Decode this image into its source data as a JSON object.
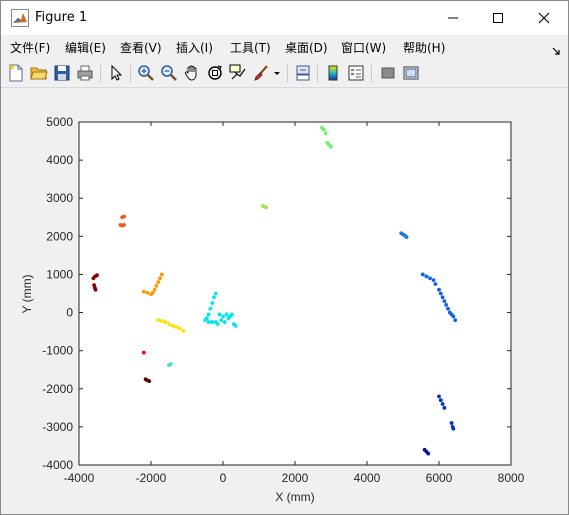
{
  "window": {
    "title": "Figure 1",
    "app_icon": "matlab-logo-icon",
    "controls": [
      "minimize-icon",
      "maximize-icon",
      "close-icon"
    ]
  },
  "menu": {
    "items": [
      "文件(F)",
      "编辑(E)",
      "查看(V)",
      "插入(I)",
      "工具(T)",
      "桌面(D)",
      "窗口(W)",
      "帮助(H)"
    ],
    "overflow_icon": "dock-arrow-icon"
  },
  "toolbar": {
    "icons": [
      "new-figure-icon",
      "open-file-icon",
      "save-icon",
      "print-icon",
      "edit-plot-arrow-icon",
      "zoom-in-icon",
      "zoom-out-icon",
      "pan-hand-icon",
      "rotate-3d-icon",
      "data-cursor-icon",
      "brush-icon",
      "brush-dropdown-icon",
      "link-plot-icon",
      "insert-colorbar-icon",
      "insert-legend-icon",
      "hide-plot-tools-icon",
      "show-plot-tools-icon"
    ]
  },
  "chart_data": {
    "type": "scatter",
    "title": "",
    "xlabel": "X (mm)",
    "ylabel": "Y (mm)",
    "xlim": [
      -4000,
      8000
    ],
    "ylim": [
      -4000,
      5000
    ],
    "xticks": [
      "-4000",
      "-2000",
      "0",
      "2000",
      "4000",
      "6000",
      "8000"
    ],
    "yticks": [
      "-4000",
      "-3000",
      "-2000",
      "-1000",
      "0",
      "1000",
      "2000",
      "3000",
      "4000",
      "5000"
    ],
    "grid": false,
    "clusters": [
      {
        "color": "#8b0000",
        "points": [
          [
            -3600,
            900
          ],
          [
            -3550,
            950
          ],
          [
            -3500,
            980
          ],
          [
            -3580,
            720
          ],
          [
            -3560,
            650
          ],
          [
            -3540,
            600
          ]
        ]
      },
      {
        "color": "#e8581c",
        "points": [
          [
            -2800,
            2500
          ],
          [
            -2750,
            2520
          ],
          [
            -2850,
            2300
          ],
          [
            -2800,
            2280
          ],
          [
            -2750,
            2300
          ]
        ]
      },
      {
        "color": "#ff9a00",
        "points": [
          [
            -2200,
            550
          ],
          [
            -2100,
            520
          ],
          [
            -2000,
            480
          ],
          [
            -1950,
            520
          ],
          [
            -1900,
            600
          ],
          [
            -1850,
            700
          ],
          [
            -1800,
            800
          ],
          [
            -1750,
            900
          ],
          [
            -1700,
            1000
          ]
        ]
      },
      {
        "color": "#ffe000",
        "points": [
          [
            -1800,
            -200
          ],
          [
            -1700,
            -220
          ],
          [
            -1600,
            -250
          ],
          [
            -1500,
            -300
          ],
          [
            -1400,
            -350
          ],
          [
            -1300,
            -380
          ],
          [
            -1200,
            -420
          ],
          [
            -1100,
            -480
          ]
        ]
      },
      {
        "color": "#ff0000",
        "points": [
          [
            -2200,
            -1050
          ]
        ]
      },
      {
        "color": "#5a0000",
        "points": [
          [
            -2150,
            -1750
          ],
          [
            -2100,
            -1780
          ],
          [
            -2050,
            -1800
          ]
        ]
      },
      {
        "color": "#40e0d0",
        "points": [
          [
            -1500,
            -1380
          ],
          [
            -1450,
            -1350
          ]
        ]
      },
      {
        "color": "#00e5ee",
        "points": [
          [
            -500,
            -200
          ],
          [
            -450,
            -150
          ],
          [
            -400,
            -50
          ],
          [
            -350,
            100
          ],
          [
            -300,
            250
          ],
          [
            -250,
            400
          ],
          [
            -200,
            500
          ],
          [
            -400,
            -250
          ],
          [
            -300,
            -250
          ],
          [
            -200,
            -250
          ],
          [
            -50,
            -200
          ],
          [
            0,
            -100
          ],
          [
            50,
            -250
          ],
          [
            100,
            -50
          ],
          [
            150,
            -150
          ],
          [
            200,
            -100
          ],
          [
            250,
            -50
          ],
          [
            300,
            -300
          ],
          [
            350,
            -350
          ],
          [
            -100,
            -50
          ],
          [
            -150,
            -300
          ]
        ]
      },
      {
        "color": "#a8e05a",
        "points": [
          [
            1100,
            2800
          ],
          [
            1150,
            2780
          ],
          [
            1200,
            2760
          ]
        ]
      },
      {
        "color": "#6cf56c",
        "points": [
          [
            2750,
            4850
          ],
          [
            2800,
            4800
          ],
          [
            2850,
            4700
          ],
          [
            2900,
            4450
          ],
          [
            2950,
            4400
          ],
          [
            3000,
            4350
          ]
        ]
      },
      {
        "color": "#1e78e6",
        "points": [
          [
            4950,
            2080
          ],
          [
            5000,
            2050
          ],
          [
            5050,
            2020
          ],
          [
            5100,
            1980
          ]
        ]
      },
      {
        "color": "#1060e0",
        "points": [
          [
            5550,
            1000
          ],
          [
            5650,
            950
          ],
          [
            5750,
            900
          ],
          [
            5850,
            850
          ],
          [
            5900,
            750
          ],
          [
            6000,
            600
          ],
          [
            6050,
            500
          ],
          [
            6100,
            400
          ],
          [
            6150,
            300
          ],
          [
            6200,
            200
          ],
          [
            6250,
            100
          ],
          [
            6300,
            0
          ],
          [
            6350,
            -50
          ],
          [
            6400,
            -100
          ],
          [
            6450,
            -200
          ]
        ]
      },
      {
        "color": "#0030c8",
        "points": [
          [
            6000,
            -2200
          ],
          [
            6050,
            -2300
          ],
          [
            6100,
            -2400
          ],
          [
            6150,
            -2500
          ],
          [
            6350,
            -2900
          ],
          [
            6380,
            -3000
          ],
          [
            6400,
            -3050
          ]
        ]
      },
      {
        "color": "#0010a0",
        "points": [
          [
            5600,
            -3600
          ],
          [
            5650,
            -3650
          ],
          [
            5700,
            -3700
          ]
        ]
      }
    ]
  }
}
